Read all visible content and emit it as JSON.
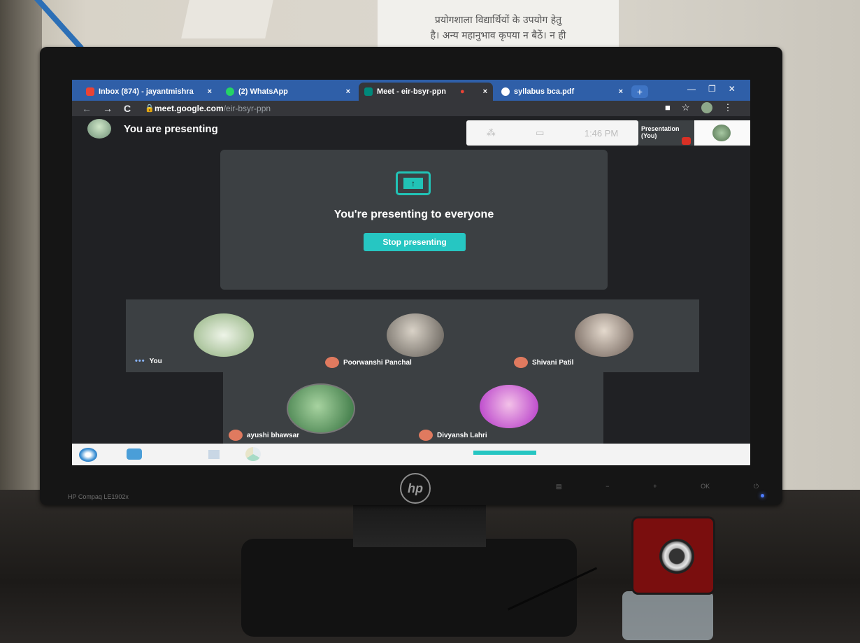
{
  "notice": {
    "line1": "प्रयोगशाला विद्यार्थियों के उपयोग हेतु",
    "line2": "है। अन्य महानुभाव कृपया न बैठें। न ही"
  },
  "monitor": {
    "model": "HP Compaq LE1902x",
    "logo": "hp",
    "buttons": [
      "▤",
      "−",
      "+",
      "OK",
      "⏻"
    ]
  },
  "browser": {
    "tabs": [
      {
        "label": "Inbox (874) - jayantmishra",
        "icon": "gmail-icon",
        "color": "#ea4335"
      },
      {
        "label": "(2) WhatsApp",
        "icon": "whatsapp-icon",
        "color": "#25d366"
      },
      {
        "label": "Meet - eir-bsyr-ppn",
        "icon": "meet-icon",
        "color": "#00897b",
        "active": true
      },
      {
        "label": "syllabus bca.pdf",
        "icon": "chrome-doc-icon",
        "color": "#ffffff"
      }
    ],
    "close_glyph": "×",
    "new_tab": "+",
    "url_host": "meet.google.com",
    "url_path": "/eir-bsyr-ppn"
  },
  "meet": {
    "header_title": "You are presenting",
    "clock": "1:46 PM",
    "mini_presentation_label": "Presentation (You)",
    "present_message": "You're presenting to everyone",
    "stop_button": "Stop presenting",
    "participants": [
      {
        "name": "You",
        "muted": false
      },
      {
        "name": "Poorwanshi Panchal",
        "muted": true
      },
      {
        "name": "Shivani Patil",
        "muted": true
      },
      {
        "name": "ayushi bhawsar",
        "muted": true
      },
      {
        "name": "Divyansh Lahri",
        "muted": true
      }
    ]
  },
  "colors": {
    "accent": "#26c6c2",
    "tab_bar": "#2f5fa8",
    "meet_bg": "#202124",
    "tile_bg": "#3c4043"
  }
}
